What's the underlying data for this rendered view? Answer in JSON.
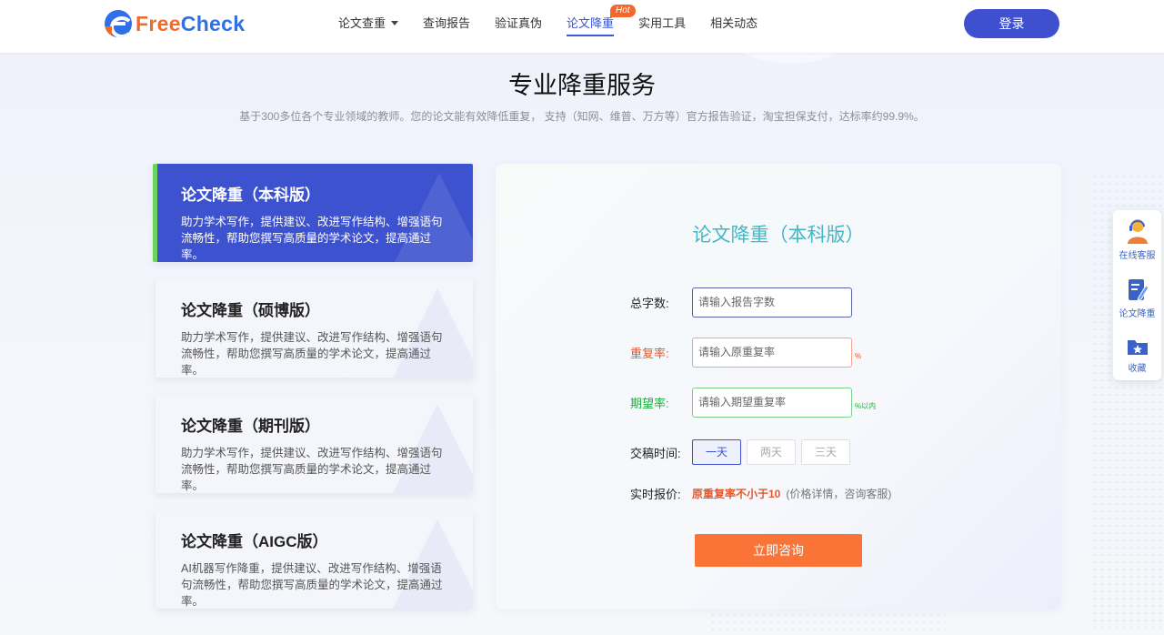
{
  "header": {
    "logo": {
      "free": "Free",
      "check": "Check"
    },
    "nav": [
      {
        "label": "论文查重",
        "has_dropdown": true
      },
      {
        "label": "查询报告"
      },
      {
        "label": "验证真伪"
      },
      {
        "label": "论文降重",
        "active": true,
        "badge": "Hot"
      },
      {
        "label": "实用工具"
      },
      {
        "label": "相关动态"
      }
    ],
    "login_label": "登录"
  },
  "main": {
    "title": "专业降重服务",
    "subtitle": "基于300多位各个专业领域的教师。您的论文能有效降低重复， 支持（知网、维普、万方等）官方报告验证，淘宝担保支付，达标率约99.9%。"
  },
  "services": [
    {
      "title": "论文降重（本科版）",
      "desc": "助力学术写作，提供建议、改进写作结构、增强语句流畅性，帮助您撰写高质量的学术论文，提高通过率。",
      "active": true
    },
    {
      "title": "论文降重（硕博版）",
      "desc": "助力学术写作，提供建议、改进写作结构、增强语句流畅性，帮助您撰写高质量的学术论文，提高通过率。"
    },
    {
      "title": "论文降重（期刊版）",
      "desc": "助力学术写作，提供建议、改进写作结构、增强语句流畅性，帮助您撰写高质量的学术论文，提高通过率。"
    },
    {
      "title": "论文降重（AIGC版）",
      "desc": "AI机器写作降重，提供建议、改进写作结构、增强语句流畅性，帮助您撰写高质量的学术论文，提高通过率。"
    }
  ],
  "form": {
    "title": "论文降重（本科版）",
    "word_count": {
      "label": "总字数:",
      "placeholder": "请输入报告字数",
      "value": ""
    },
    "repeat_rate": {
      "label": "重复率:",
      "placeholder": "请输入原重复率",
      "value": "",
      "unit": "%"
    },
    "expected_rate": {
      "label": "期望率:",
      "placeholder": "请输入期望重复率",
      "value": "",
      "unit": "%以内"
    },
    "delivery": {
      "label": "交稿时间:",
      "options": [
        "一天",
        "两天",
        "三天"
      ],
      "selected": "一天"
    },
    "price": {
      "label": "实时报价:",
      "highlight": "原重复率不小于10",
      "note": "(价格详情，咨询客服)"
    },
    "submit_label": "立即咨询"
  },
  "float_bar": [
    {
      "label": "在线客服",
      "icon": "customer-service-icon"
    },
    {
      "label": "论文降重",
      "icon": "edit-document-icon"
    },
    {
      "label": "收藏",
      "icon": "favorite-folder-icon"
    }
  ],
  "colors": {
    "primary": "#3e50d0",
    "accent_orange": "#f97436",
    "red": "#e4572e",
    "green": "#1fae3e",
    "panel_title": "#45b7c4"
  }
}
